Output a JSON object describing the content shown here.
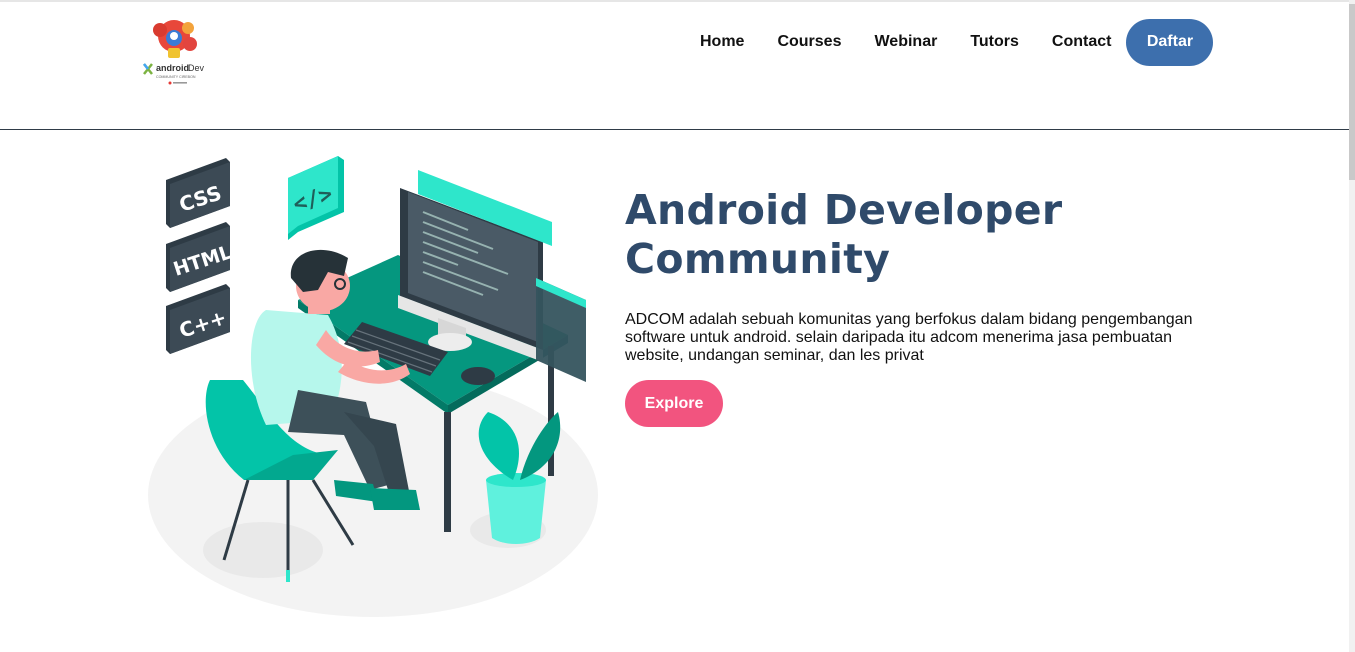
{
  "logo": {
    "line1": "android",
    "line2": "Dev",
    "line3": "COMMUNITY CIREBON"
  },
  "nav": {
    "links": [
      "Home",
      "Courses",
      "Webinar",
      "Tutors",
      "Contact"
    ],
    "cta": "Daftar"
  },
  "hero": {
    "title": "Android Developer Community",
    "description": "ADCOM adalah sebuah komunitas yang berfokus dalam bidang pengembangan software untuk android. selain daripada itu adcom menerima jasa pembuatan website, undangan seminar, dan les privat",
    "button": "Explore"
  },
  "illustration": {
    "tags": [
      "CSS",
      "HTML",
      "C++"
    ],
    "code_badge": "</>"
  },
  "colors": {
    "brand_blue": "#3d6fad",
    "accent_pink": "#f2547f",
    "title_navy": "#2f4a6a",
    "teal": "#03c4a8"
  }
}
